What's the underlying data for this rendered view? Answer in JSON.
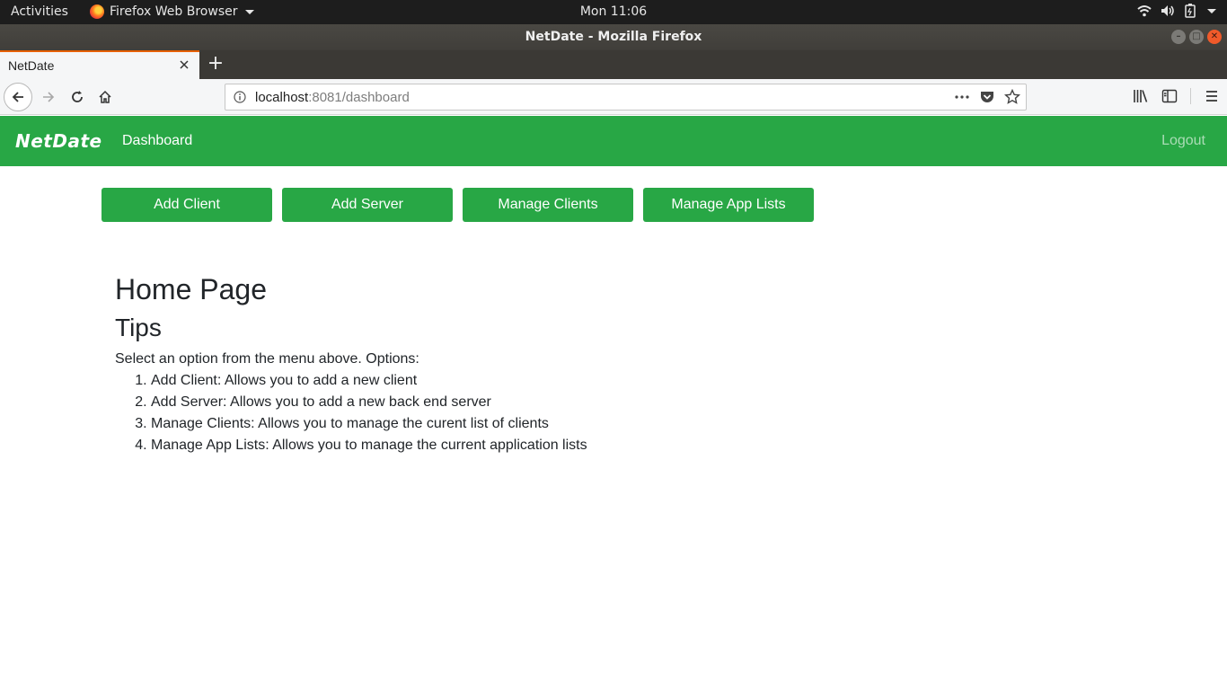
{
  "system": {
    "activities": "Activities",
    "app_name": "Firefox Web Browser",
    "clock": "Mon 11:06"
  },
  "window": {
    "title": "NetDate - Mozilla Firefox"
  },
  "tab": {
    "title": "NetDate"
  },
  "urlbar": {
    "host": "localhost",
    "rest": ":8081/dashboard"
  },
  "app": {
    "brand": "NetDate",
    "nav_dashboard": "Dashboard",
    "nav_logout": "Logout",
    "buttons": [
      "Add Client",
      "Add Server",
      "Manage Clients",
      "Manage App Lists"
    ],
    "heading": "Home Page",
    "subheading": "Tips",
    "intro": "Select an option from the menu above. Options:",
    "tips": [
      "Add Client: Allows you to add a new client",
      "Add Server: Allows you to add a new back end server",
      "Manage Clients: Allows you to manage the curent list of clients",
      "Manage App Lists: Allows you to manage the current application lists"
    ]
  },
  "colors": {
    "brand_green": "#28a745",
    "text": "#212529"
  }
}
